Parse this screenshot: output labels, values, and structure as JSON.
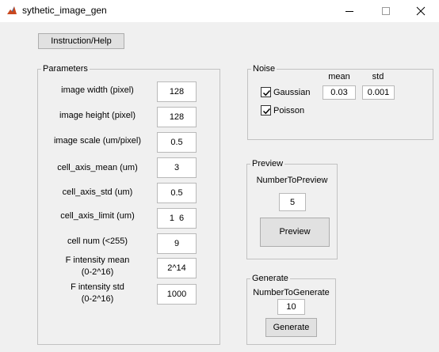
{
  "window": {
    "title": "sythetic_image_gen",
    "icon": "matlab-figure-icon",
    "controls": [
      "minimize-icon",
      "maximize-icon",
      "close-icon"
    ]
  },
  "help_button": "Instruction/Help",
  "parameters": {
    "title": "Parameters",
    "rows": [
      {
        "label": "image width (pixel)",
        "value": "128"
      },
      {
        "label": "image height (pixel)",
        "value": "128"
      },
      {
        "label": "image scale (um/pixel)",
        "value": "0.5"
      },
      {
        "label": "cell_axis_mean (um)",
        "value": "3"
      },
      {
        "label": "cell_axis_std (um)",
        "value": "0.5"
      },
      {
        "label": "cell_axis_limit (um)",
        "value": "1  6"
      },
      {
        "label": "cell num (<255)",
        "value": "9"
      },
      {
        "label_line1": "F intensity mean",
        "label_line2": "(0-2^16)",
        "value": "2^14"
      },
      {
        "label_line1": "F intensity std",
        "label_line2": "(0-2^16)",
        "value": "1000"
      }
    ]
  },
  "noise": {
    "title": "Noise",
    "mean_header": "mean",
    "std_header": "std",
    "gaussian": {
      "label": "Gaussian",
      "checked": true,
      "mean": "0.03",
      "std": "0.001"
    },
    "poisson": {
      "label": "Poisson",
      "checked": true
    }
  },
  "preview": {
    "title": "Preview",
    "number_label": "NumberToPreview",
    "number_value": "5",
    "button": "Preview"
  },
  "generate": {
    "title": "Generate",
    "number_label": "NumberToGenerate",
    "number_value": "10",
    "button": "Generate"
  }
}
